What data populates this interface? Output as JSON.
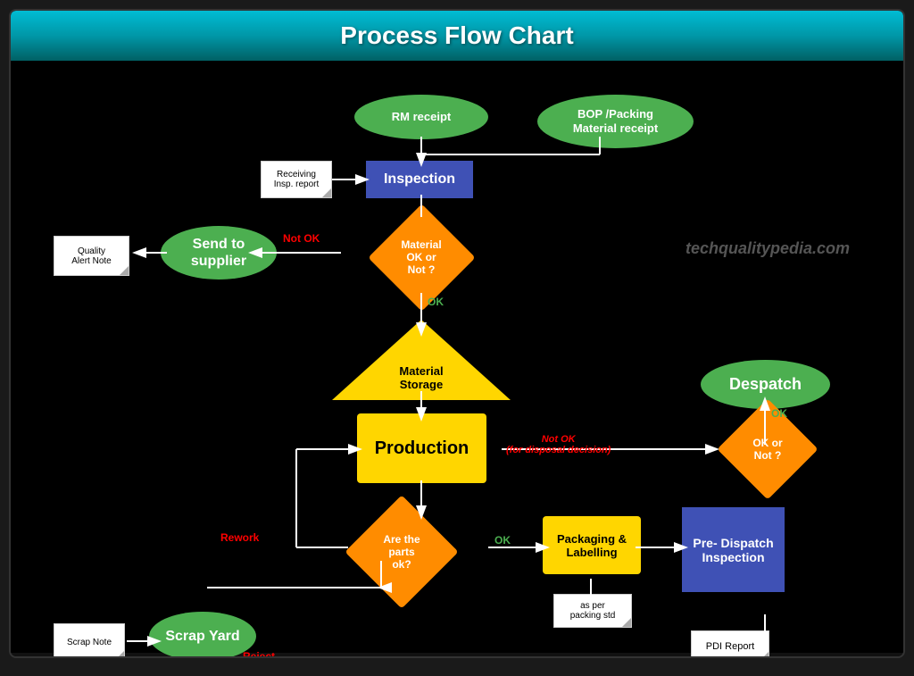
{
  "title": "Process Flow Chart",
  "watermark": "techqualitypedia.com",
  "nodes": {
    "rm_receipt": {
      "label": "RM receipt"
    },
    "bop_packing": {
      "label": "BOP /Packing\nMaterial receipt"
    },
    "inspection": {
      "label": "Inspection"
    },
    "receiving_report": {
      "label": "Receiving\nInsp. report"
    },
    "material_ok": {
      "label": "Material\nOK or\nNot ?"
    },
    "quality_alert": {
      "label": "Quality\nAlert Note"
    },
    "send_supplier": {
      "label": "Send to\nsupplier"
    },
    "material_storage": {
      "label": "Material\nStorage"
    },
    "production": {
      "label": "Production"
    },
    "despatch": {
      "label": "Despatch"
    },
    "ok_or_not": {
      "label": "OK or\nNot ?"
    },
    "not_ok_disposal": {
      "label": "Not OK\n(for disposal decision)"
    },
    "are_parts_ok": {
      "label": "Are the\nparts\nok?"
    },
    "rework": {
      "label": "Rework"
    },
    "packaging": {
      "label": "Packaging &\nLabelling"
    },
    "pre_dispatch": {
      "label": "Pre-\nDispatch\nInspection"
    },
    "scrap_yard": {
      "label": "Scrap\nYard"
    },
    "scrap_note": {
      "label": "Scrap Note"
    },
    "reject": {
      "label": "Reject"
    },
    "pdi_report": {
      "label": "PDI Report"
    },
    "as_per_packing": {
      "label": "as per\npacking std"
    },
    "ok_label_1": {
      "label": "OK"
    },
    "ok_label_2": {
      "label": "OK"
    },
    "ok_label_3": {
      "label": "OK"
    },
    "not_ok_label": {
      "label": "Not OK"
    }
  }
}
